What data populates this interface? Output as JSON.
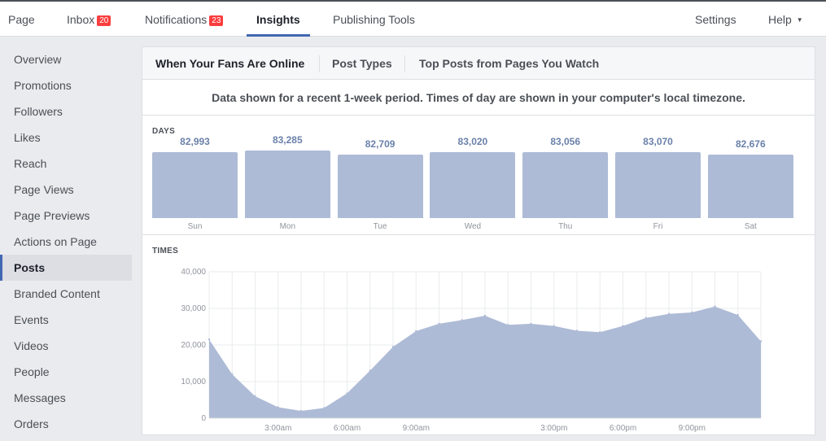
{
  "topnav": {
    "page": "Page",
    "inbox": "Inbox",
    "inbox_count": "20",
    "notifications": "Notifications",
    "notifications_count": "23",
    "insights": "Insights",
    "publishing_tools": "Publishing Tools",
    "settings": "Settings",
    "help": "Help"
  },
  "sidebar": {
    "items": [
      {
        "label": "Overview"
      },
      {
        "label": "Promotions"
      },
      {
        "label": "Followers"
      },
      {
        "label": "Likes"
      },
      {
        "label": "Reach"
      },
      {
        "label": "Page Views"
      },
      {
        "label": "Page Previews"
      },
      {
        "label": "Actions on Page"
      },
      {
        "label": "Posts"
      },
      {
        "label": "Branded Content"
      },
      {
        "label": "Events"
      },
      {
        "label": "Videos"
      },
      {
        "label": "People"
      },
      {
        "label": "Messages"
      },
      {
        "label": "Orders"
      }
    ],
    "active_index": 8
  },
  "subtabs": {
    "fans_online": "When Your Fans Are Online",
    "post_types": "Post Types",
    "top_posts": "Top Posts from Pages You Watch"
  },
  "notice": "Data shown for a recent 1-week period. Times of day are shown in your computer's local timezone.",
  "days": {
    "label": "DAYS",
    "items": [
      {
        "day": "Sun",
        "value": "82,993",
        "raw": 82993
      },
      {
        "day": "Mon",
        "value": "83,285",
        "raw": 83285
      },
      {
        "day": "Tue",
        "value": "82,709",
        "raw": 82709
      },
      {
        "day": "Wed",
        "value": "83,020",
        "raw": 83020
      },
      {
        "day": "Thu",
        "value": "83,056",
        "raw": 83056
      },
      {
        "day": "Fri",
        "value": "83,070",
        "raw": 83070
      },
      {
        "day": "Sat",
        "value": "82,676",
        "raw": 82676
      }
    ]
  },
  "times": {
    "label": "TIMES"
  },
  "colors": {
    "accent": "#4267b2",
    "bar": "#aebbd6",
    "area": "#aebbd6",
    "badge": "#fa3e3e"
  },
  "chart_data": {
    "type": "area",
    "x_hours": [
      0,
      1,
      2,
      3,
      4,
      5,
      6,
      7,
      8,
      9,
      10,
      11,
      12,
      13,
      14,
      15,
      16,
      17,
      18,
      19,
      20,
      21,
      22,
      23,
      24
    ],
    "y": [
      21500,
      12000,
      6000,
      3000,
      2000,
      2800,
      6800,
      13000,
      19500,
      23800,
      25800,
      26800,
      28000,
      25500,
      25800,
      25200,
      23900,
      23500,
      25200,
      27400,
      28500,
      28900,
      30500,
      28200,
      21000
    ],
    "ylim": [
      0,
      40000
    ],
    "y_ticks": [
      "40,000",
      "30,000",
      "20,000",
      "10,000",
      "0"
    ],
    "y_tick_values": [
      40000,
      30000,
      20000,
      10000,
      0
    ],
    "x_ticks": [
      {
        "hour": 3,
        "label": "3:00am"
      },
      {
        "hour": 6,
        "label": "6:00am"
      },
      {
        "hour": 9,
        "label": "9:00am"
      },
      {
        "hour": 15,
        "label": "3:00pm"
      },
      {
        "hour": 18,
        "label": "6:00pm"
      },
      {
        "hour": 21,
        "label": "9:00pm"
      }
    ],
    "grid": true
  }
}
